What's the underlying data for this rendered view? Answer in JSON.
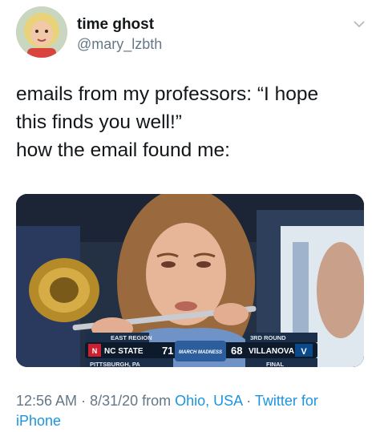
{
  "author": {
    "display_name": "time ghost",
    "handle": "@mary_lzbth",
    "avatar_icon": "profile-photo"
  },
  "menu_icon": "chevron-down-icon",
  "tweet": {
    "lines": [
      "emails from my professors: “I hope",
      "this finds you well!”",
      "how the email found me:"
    ]
  },
  "media": {
    "description_icon": "photo",
    "scoreboard": {
      "region": "EAST REGION",
      "round": "3RD ROUND",
      "team1": "NC STATE",
      "score1": "71",
      "score2": "68",
      "team2": "VILLANOVA",
      "event": "MARCH MADNESS",
      "location": "PITTSBURGH, PA",
      "status": "FINAL"
    }
  },
  "footer": {
    "time": "12:56 AM",
    "separator1": " · ",
    "date": "8/31/20",
    "from": " from ",
    "location": "Ohio, USA",
    "separator2": " · ",
    "source": "Twitter for",
    "source2": "iPhone"
  },
  "colors": {
    "text": "#14171a",
    "secondary": "#657786",
    "link": "#1b95e0"
  }
}
